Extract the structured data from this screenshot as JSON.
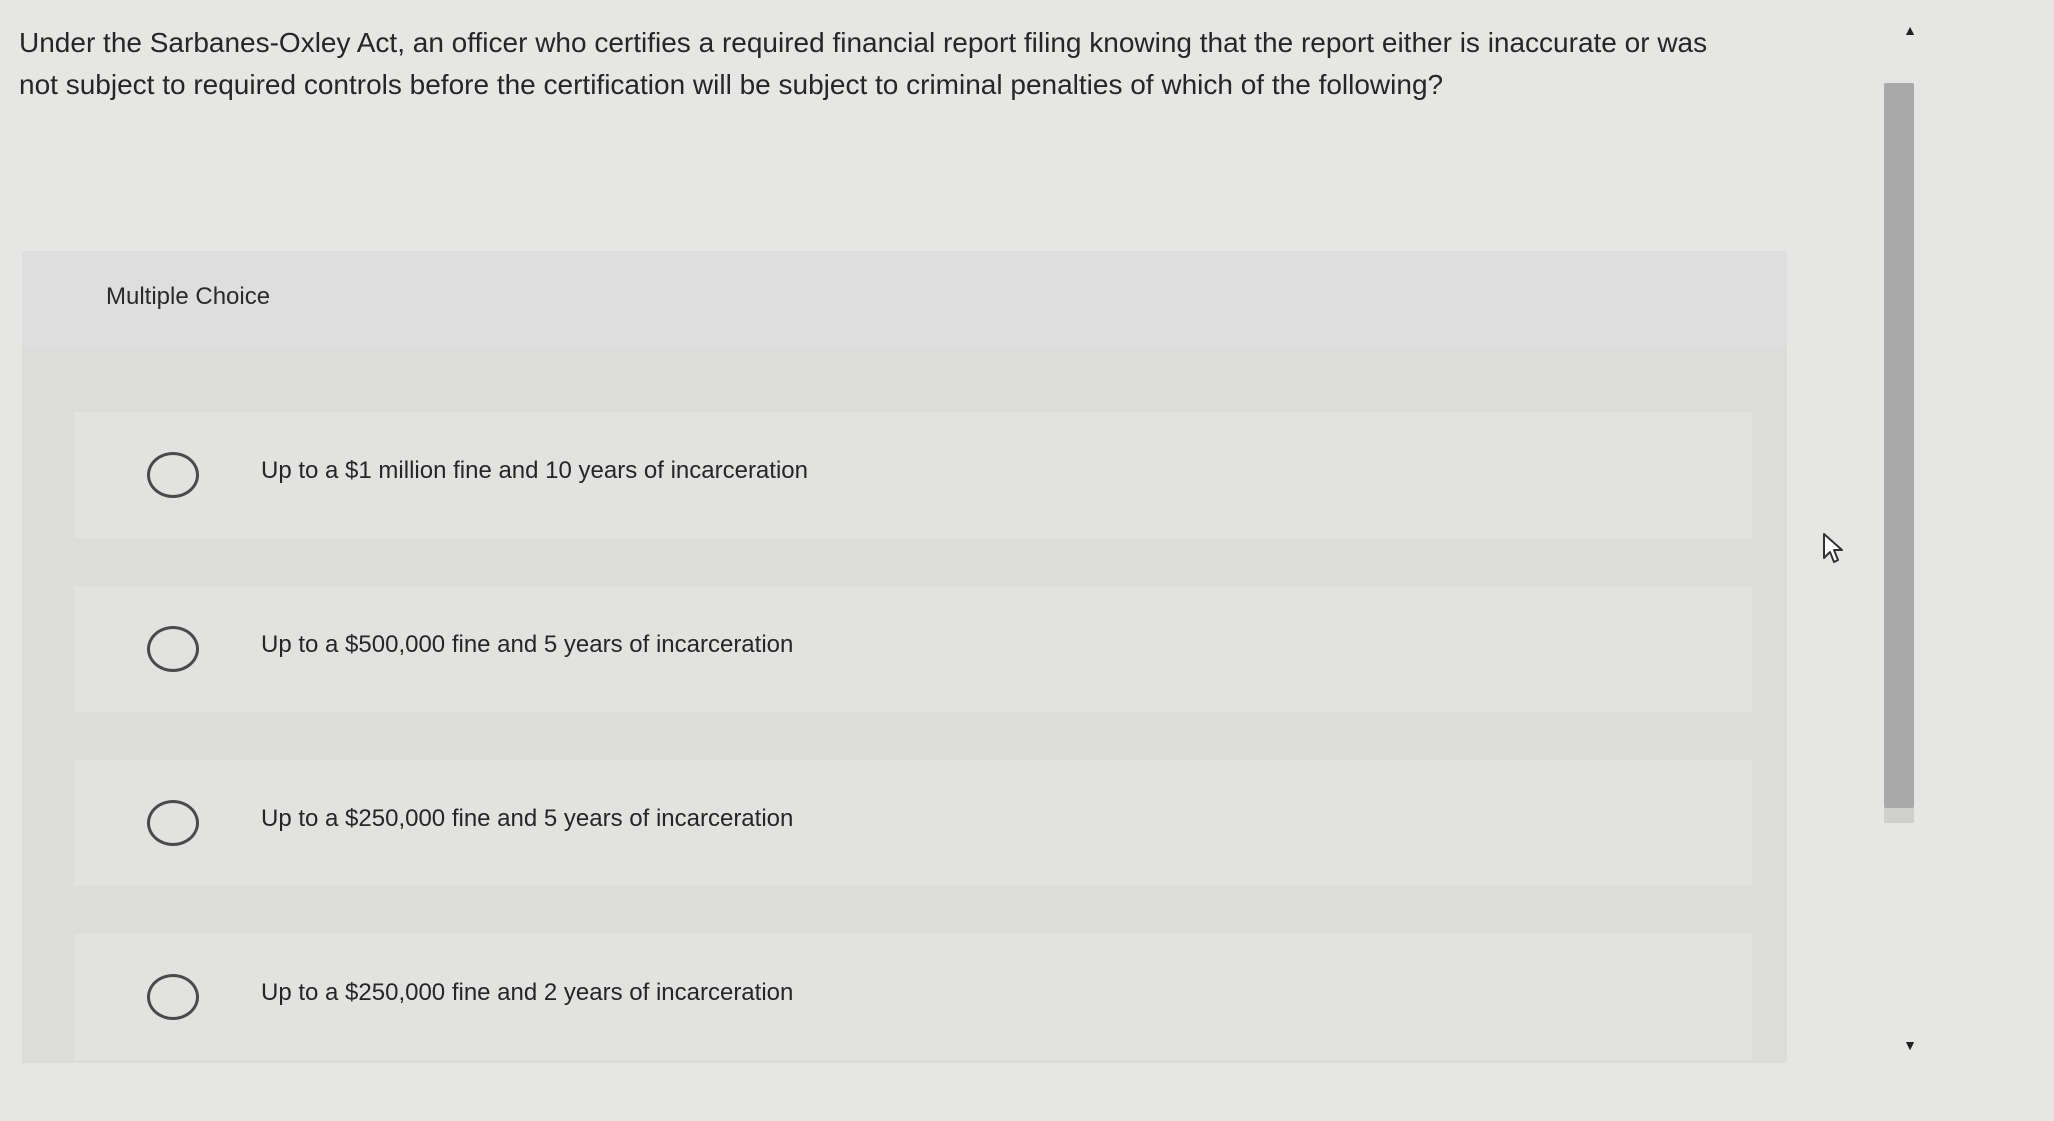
{
  "question": {
    "text": "Under the Sarbanes-Oxley Act, an officer who certifies a required financial report filing knowing that the report either is inaccurate or was not subject to required controls before the certification will be subject to criminal penalties of which of the following?"
  },
  "multiple_choice": {
    "label": "Multiple Choice",
    "options": [
      {
        "text": "Up to a $1 million fine and 10 years of incarceration"
      },
      {
        "text": "Up to a $500,000 fine and 5 years of incarceration"
      },
      {
        "text": "Up to a $250,000 fine and 5 years of incarceration"
      },
      {
        "text": "Up to a $250,000 fine and 2 years of incarceration"
      }
    ]
  },
  "scrollbar": {
    "up_icon": "triangle-up-icon",
    "down_icon": "triangle-down-icon"
  },
  "cursor": {
    "icon": "mouse-pointer-icon"
  },
  "colors": {
    "background": "#e6e6e4",
    "panel": "#dcdcda",
    "option_bg": "#e2e2e0",
    "text": "#262626",
    "scroll_thumb": "#a9a9a9"
  }
}
